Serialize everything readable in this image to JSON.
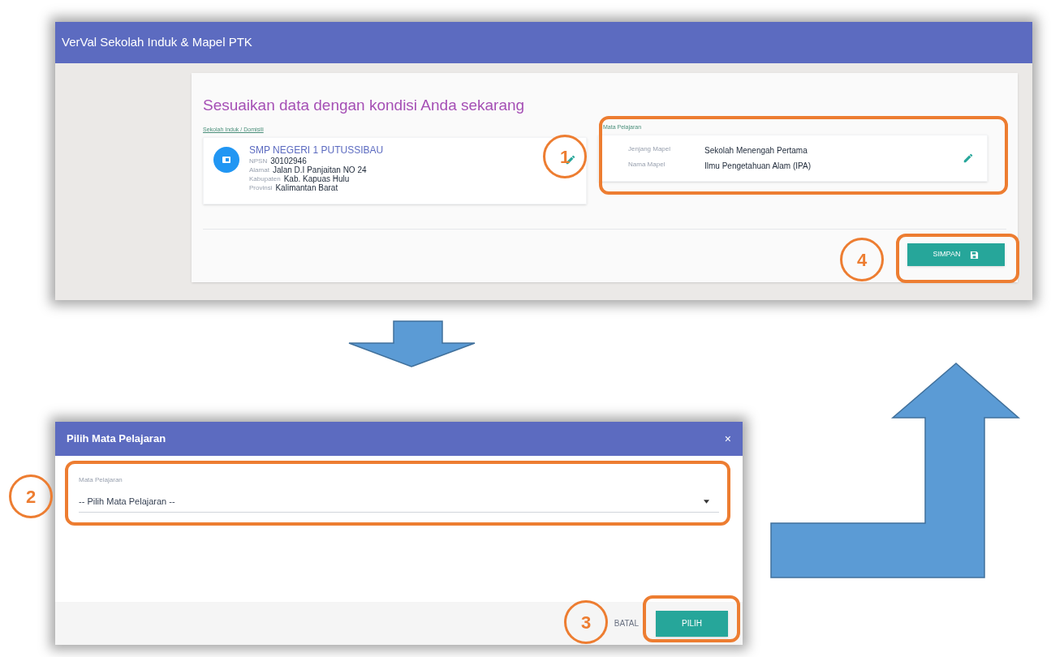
{
  "main_window": {
    "title": "VerVal Sekolah Induk & Mapel PTK",
    "heading": "Sesuaikan data dengan kondisi Anda sekarang",
    "school_section": {
      "label": "Sekolah Induk / Domisili",
      "name": "SMP NEGERI 1 PUTUSSIBAU",
      "fields": [
        {
          "label": "NPSN",
          "value": "30102946"
        },
        {
          "label": "Alamat",
          "value": "Jalan D.I Panjaitan NO 24"
        },
        {
          "label": "Kabupaten",
          "value": "Kab. Kapuas Hulu"
        },
        {
          "label": "Provinsi",
          "value": "Kalimantan Barat"
        }
      ]
    },
    "subject_section": {
      "label": "Mata Pelajaran",
      "fields": [
        {
          "label": "Jenjang Mapel",
          "value": "Sekolah Menengah Pertama"
        },
        {
          "label": "Nama Mapel",
          "value": "Ilmu Pengetahuan Alam (IPA)"
        }
      ]
    },
    "save_button": "SIMPAN"
  },
  "dialog": {
    "title": "Pilih Mata Pelajaran",
    "close": "×",
    "field_label": "Mata Pelajaran",
    "field_value": "-- Pilih Mata Pelajaran --",
    "cancel_button": "BATAL",
    "confirm_button": "PILIH"
  },
  "callouts": [
    "1",
    "2",
    "3",
    "4"
  ]
}
